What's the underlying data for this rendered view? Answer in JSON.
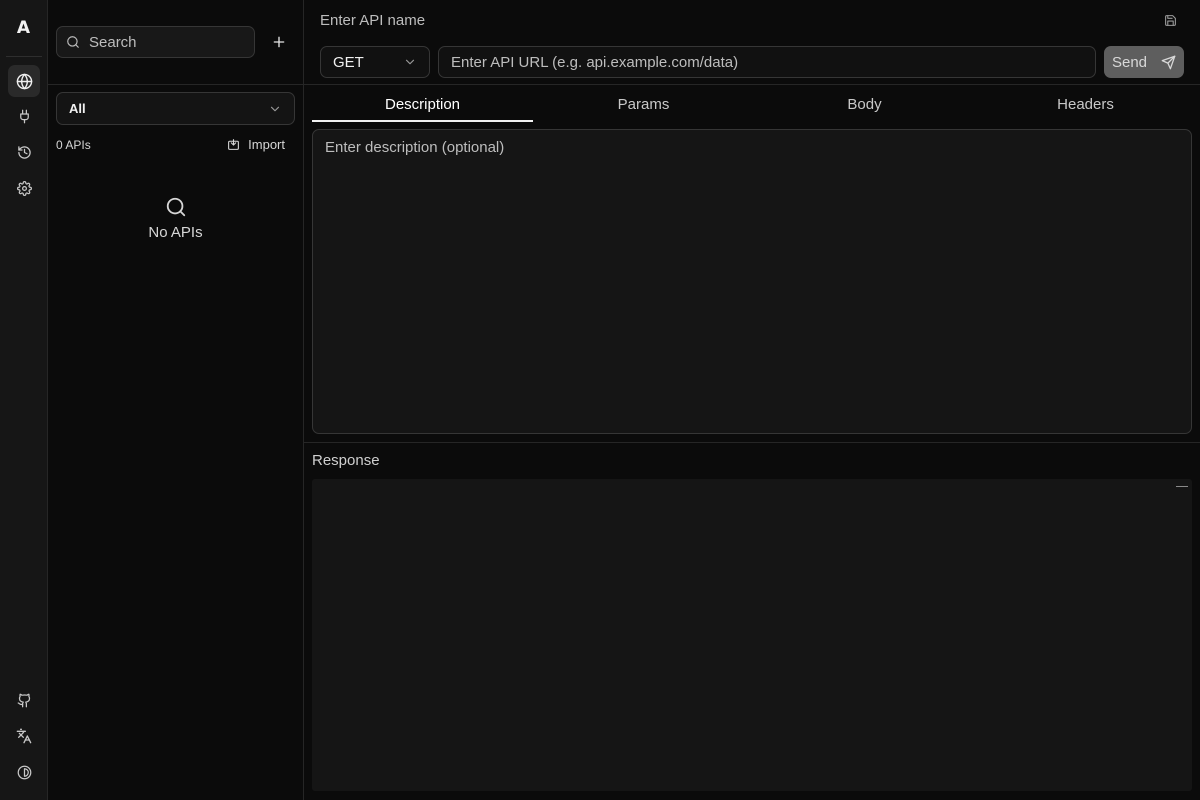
{
  "rail": {
    "logo": "A",
    "top_icons": [
      "globe-icon",
      "plug-icon",
      "history-icon",
      "settings-icon"
    ],
    "active": "globe-icon",
    "bottom_icons": [
      "github-icon",
      "translate-icon",
      "theme-icon"
    ]
  },
  "sidebar": {
    "search_placeholder": "Search",
    "add_icon": "plus-icon",
    "filter": {
      "selected": "All"
    },
    "count": "0 APIs",
    "import_label": "Import",
    "empty_text": "No APIs"
  },
  "main": {
    "name_placeholder": "Enter API name",
    "method": "GET",
    "url_placeholder": "Enter API URL (e.g. api.example.com/data)",
    "send_label": "Send",
    "tabs": [
      {
        "label": "Description",
        "active": true
      },
      {
        "label": "Params",
        "active": false
      },
      {
        "label": "Body",
        "active": false
      },
      {
        "label": "Headers",
        "active": false
      }
    ],
    "description_placeholder": "Enter description (optional)",
    "response_label": "Response"
  },
  "colors": {
    "background": "#0b0b0b",
    "panel": "#151515",
    "border": "#363636",
    "send_button": "#5e5e5e",
    "active_tab_underline": "#f2f2f2"
  }
}
